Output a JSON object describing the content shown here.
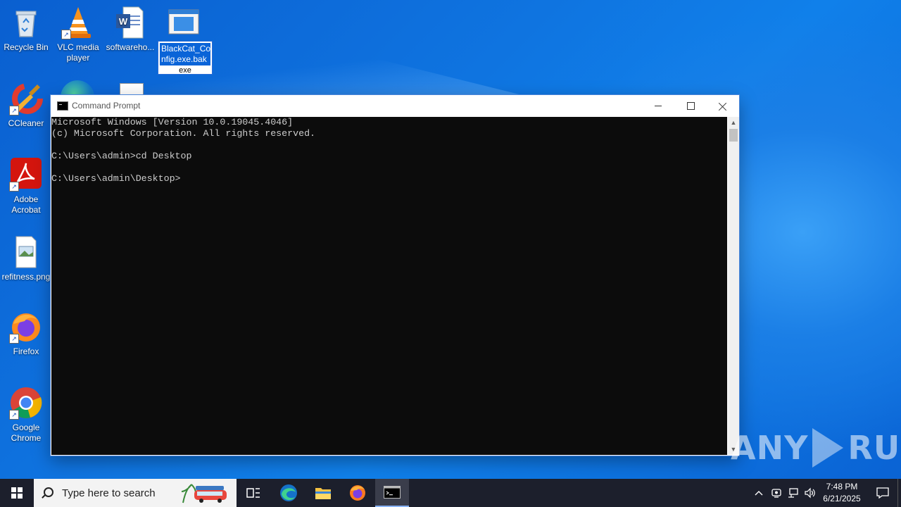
{
  "desktop_icons": [
    {
      "label": "Recycle Bin"
    },
    {
      "label": "VLC media player"
    },
    {
      "label": "softwareho..."
    },
    {
      "label": "BlackCat_Config.exe.bak",
      "label_line1": "BlackCat_Co",
      "label_line2": "nfig.exe.bak",
      "label_tail": "exe"
    },
    {
      "label": "CCleaner"
    },
    {
      "label": "Adobe Acrobat"
    },
    {
      "label": "refitness.png"
    },
    {
      "label": "Firefox"
    },
    {
      "label": "Google Chrome"
    }
  ],
  "cmd_window": {
    "title": "Command Prompt",
    "lines": [
      "Microsoft Windows [Version 10.0.19045.4046]",
      "(c) Microsoft Corporation. All rights reserved.",
      "",
      "C:\\Users\\admin>cd Desktop",
      "",
      "C:\\Users\\admin\\Desktop>"
    ]
  },
  "watermark": {
    "left": "ANY",
    "right": "RUN"
  },
  "taskbar": {
    "search_placeholder": "Type here to search",
    "pinned": [
      "task-view",
      "edge",
      "file-explorer",
      "firefox",
      "command-prompt"
    ],
    "active": "command-prompt",
    "clock_time": "7:48 PM",
    "clock_date": "6/21/2025"
  },
  "colors": {
    "wallpaper": "#0f74e0",
    "taskbar": "#1c1f2c",
    "console_bg": "#0c0c0c",
    "console_fg": "#cccccc"
  }
}
